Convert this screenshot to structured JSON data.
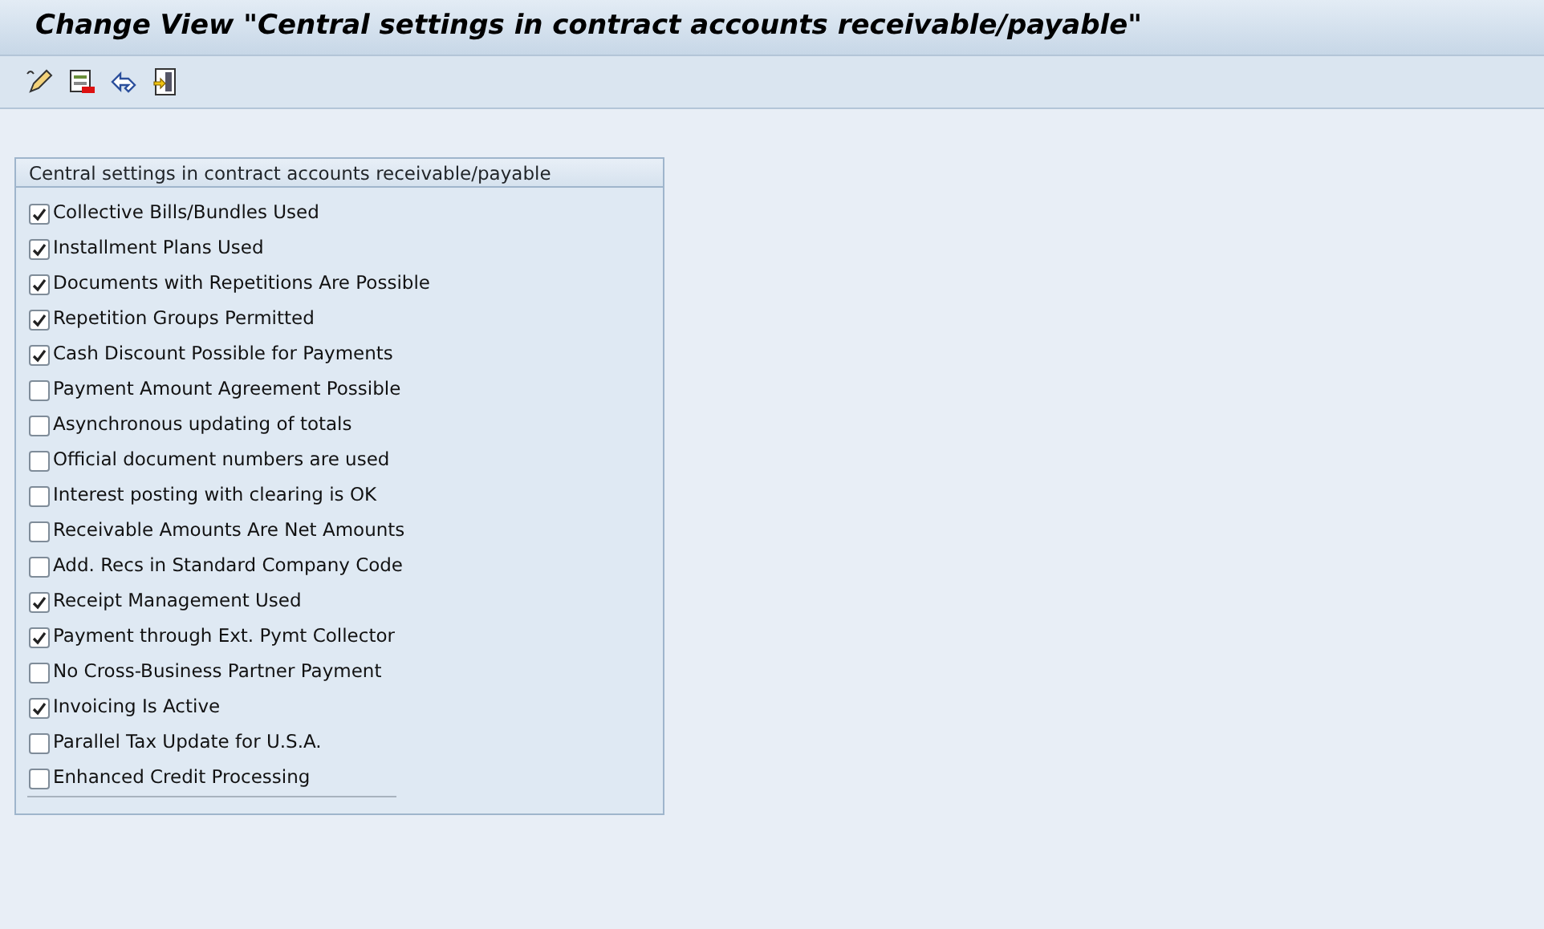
{
  "window": {
    "title": "Change View \"Central settings in contract accounts receivable/payable\""
  },
  "group": {
    "title": "Central settings in contract accounts receivable/payable",
    "items": [
      {
        "label": "Collective Bills/Bundles Used",
        "checked": true
      },
      {
        "label": "Installment Plans Used",
        "checked": true
      },
      {
        "label": "Documents with Repetitions Are Possible",
        "checked": true
      },
      {
        "label": "Repetition Groups Permitted",
        "checked": true
      },
      {
        "label": "Cash Discount Possible for Payments",
        "checked": true
      },
      {
        "label": "Payment Amount Agreement Possible",
        "checked": false
      },
      {
        "label": "Asynchronous updating of totals",
        "checked": false
      },
      {
        "label": "Official document numbers are used",
        "checked": false
      },
      {
        "label": "Interest posting with clearing is OK",
        "checked": false
      },
      {
        "label": "Receivable Amounts Are Net Amounts",
        "checked": false
      },
      {
        "label": "Add. Recs in Standard Company Code",
        "checked": false
      },
      {
        "label": "Receipt Management Used",
        "checked": true
      },
      {
        "label": "Payment through Ext. Pymt Collector",
        "checked": true
      },
      {
        "label": "No Cross-Business Partner Payment",
        "checked": false
      },
      {
        "label": "Invoicing Is Active",
        "checked": true
      },
      {
        "label": "Parallel Tax Update for U.S.A.",
        "checked": false
      },
      {
        "label": "Enhanced Credit Processing",
        "checked": false
      }
    ]
  }
}
